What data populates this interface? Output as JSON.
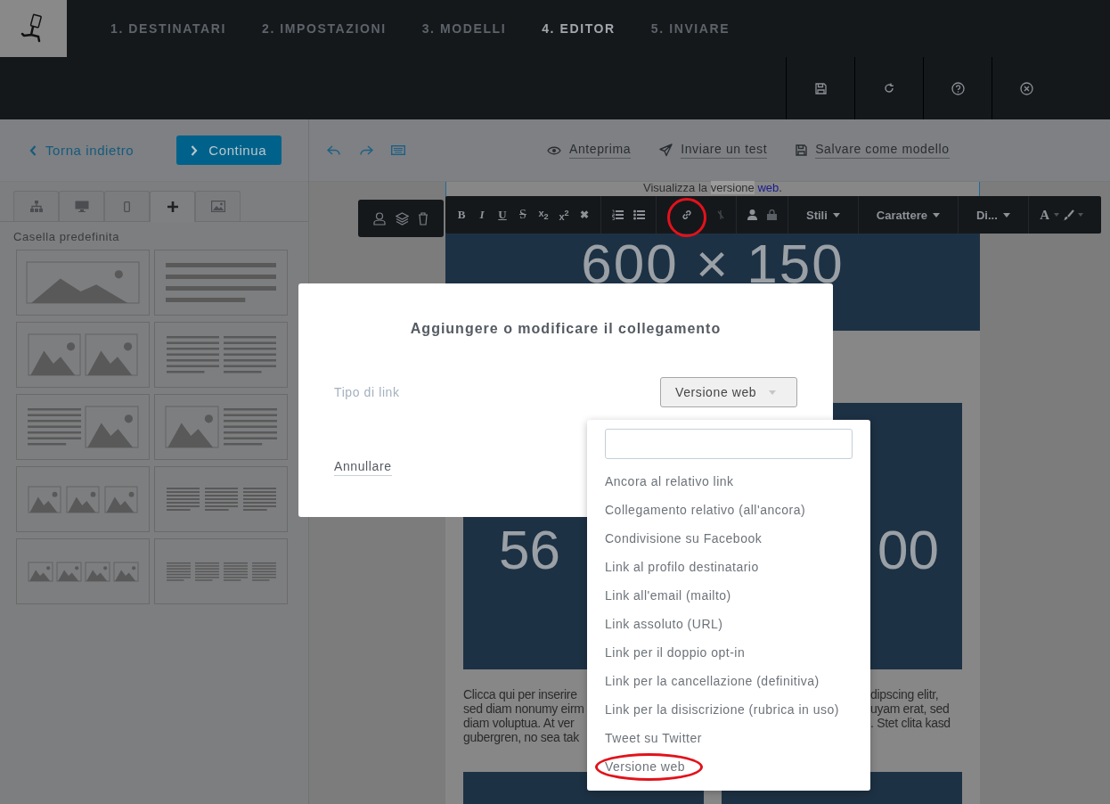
{
  "steps": [
    {
      "label": "1. DESTINATARI",
      "selected": false
    },
    {
      "label": "2. IMPOSTAZIONI",
      "selected": false
    },
    {
      "label": "3. MODELLI",
      "selected": false
    },
    {
      "label": "4. EDITOR",
      "selected": true
    },
    {
      "label": "5. INVIARE",
      "selected": false
    }
  ],
  "sidebar": {
    "back_link": "Torna indietro",
    "continue_button": "Continua",
    "tabs": [
      {
        "selected": false
      },
      {
        "selected": false
      },
      {
        "selected": false
      },
      {
        "selected": true
      },
      {
        "selected": false
      }
    ],
    "section_title": "Casella predefinita",
    "layouts": [
      {
        "kind": "image"
      },
      {
        "kind": "text"
      },
      {
        "kind": "images2"
      },
      {
        "kind": "texts2"
      },
      {
        "kind": "textimage"
      },
      {
        "kind": "imagetext"
      },
      {
        "kind": "images3"
      },
      {
        "kind": "texts3"
      },
      {
        "kind": "images4"
      },
      {
        "kind": "texts4"
      }
    ]
  },
  "editor_toolbar": {
    "preview": "Anteprima",
    "send_test": "Inviare un test",
    "save_template": "Salvare come modello"
  },
  "email": {
    "preheader": {
      "before": "Visualizza la",
      "highlighted": "versione",
      "link": "web",
      "after": "."
    },
    "header_image": "600 × 150",
    "main_image_parts": [
      "56",
      "00"
    ],
    "paragraph_left": [
      "Clicca qui per inserire",
      "sed diam nonumy eirm",
      "diam voluptua. At ver",
      "gubergren, no sea tak"
    ],
    "paragraph_right": [
      "dipscing elitr,",
      "uyam erat, sed",
      ". Stet clita kasd"
    ]
  },
  "format_toolbar": {
    "format_buttons": [
      "B",
      "I",
      "U",
      "S",
      "x$_{2}$",
      "x$^{2}$",
      "✖"
    ],
    "link_highlighted": true,
    "unlink_disabled": true,
    "dropdowns": [
      "Stili",
      "Carattere",
      "Di..."
    ],
    "color_button": "A"
  },
  "dialog": {
    "title": "Aggiungere o modificare il collegamento",
    "link_type_label": "Tipo di link",
    "link_type_value": "Versione web",
    "cancel": "Annullare"
  },
  "dropdown": {
    "options": [
      {
        "label": "Ancora al relativo link",
        "highlighted": false
      },
      {
        "label": "Collegamento relativo (all'ancora)",
        "highlighted": false
      },
      {
        "label": "Condivisione su Facebook",
        "highlighted": false
      },
      {
        "label": "Link al profilo destinatario",
        "highlighted": false
      },
      {
        "label": "Link all'email (mailto)",
        "highlighted": false
      },
      {
        "label": "Link assoluto (URL)",
        "highlighted": false
      },
      {
        "label": "Link per il doppio opt-in",
        "highlighted": false
      },
      {
        "label": "Link per la cancellazione (definitiva)",
        "highlighted": false
      },
      {
        "label": "Link per la disiscrizione (rubrica in uso)",
        "highlighted": false
      },
      {
        "label": "Tweet su Twitter",
        "highlighted": false
      },
      {
        "label": "Versione web",
        "highlighted": true
      }
    ]
  }
}
